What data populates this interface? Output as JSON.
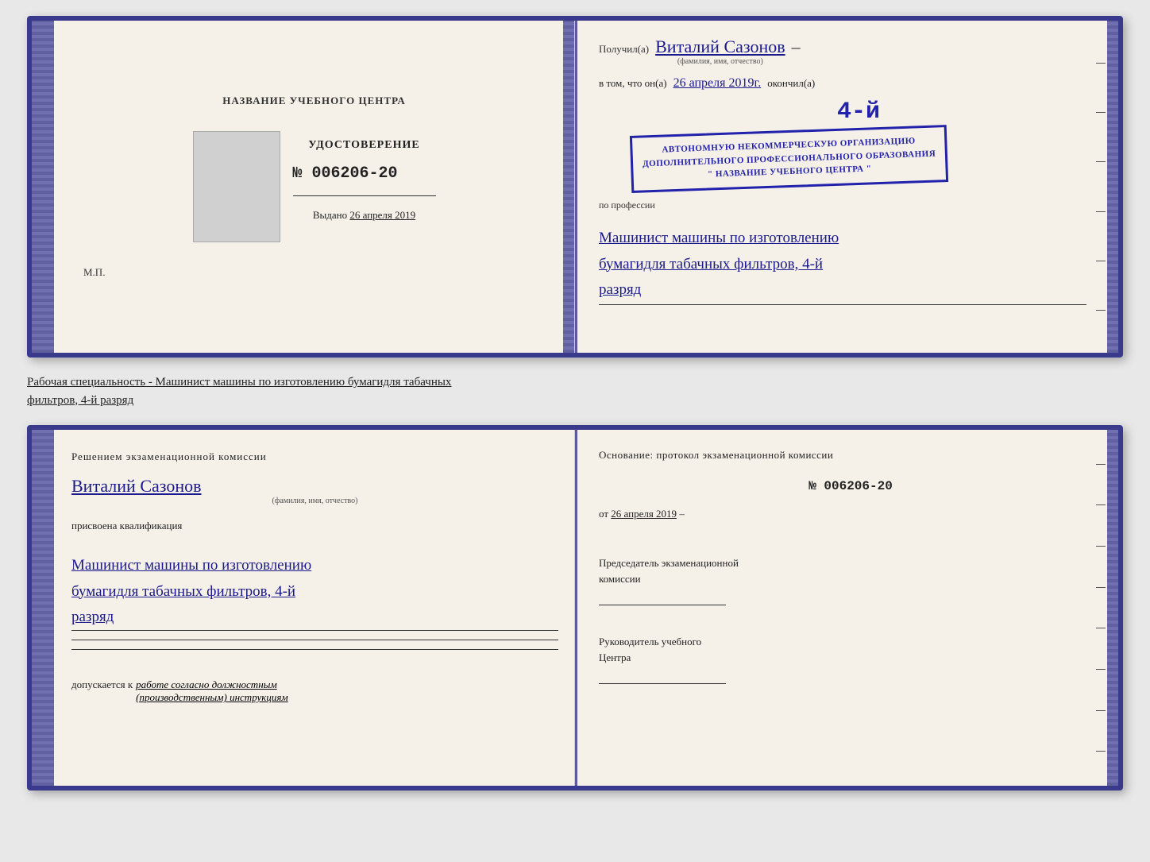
{
  "cert": {
    "left": {
      "center_label": "НАЗВАНИЕ УЧЕБНОГО ЦЕНТРА",
      "doc_type": "УДОСТОВЕРЕНИЕ",
      "doc_number": "№ 006206-20",
      "issued_label": "Выдано",
      "issued_date": "26 апреля 2019",
      "mp": "М.П."
    },
    "right": {
      "recipient_prefix": "Получил(а)",
      "recipient_name": "Виталий Сазонов",
      "recipient_subtitle": "(фамилия, имя, отчество)",
      "body_1": "в том, что он(а)",
      "date_handwritten": "26 апреля 2019г.",
      "body_2": "окончил(а)",
      "stamp_line1": "4-й",
      "stamp_line2": "АВТОНОМНУЮ НЕКОММЕРЧЕСКУЮ ОРГАНИЗАЦИЮ",
      "stamp_line3": "ДОПОЛНИТЕЛЬНОГО ПРОФЕССИОНАЛЬНОГО ОБРАЗОВАНИЯ",
      "stamp_line4": "\" НАЗВАНИЕ УЧЕБНОГО ЦЕНТРА \"",
      "profession_prefix": "по профессии",
      "profession_handwritten": "Машинист машины по изготовлению\nбумагидля табачных фильтров, 4-й\nразряд"
    }
  },
  "middle_text": {
    "static": "Рабочая специальность - Машинист машины по изготовлению бумагидля табачных",
    "underlined": "фильтров, 4-й разряд"
  },
  "qual": {
    "left": {
      "title": "Решением  экзаменационной  комиссии",
      "person_name": "Виталий Сазонов",
      "person_subtitle": "(фамилия, имя, отчество)",
      "qualification_label": "присвоена квалификация",
      "qualification_handwritten": "Машинист машины по изготовлению\nбумагидля табачных фильтров, 4-й\nразряд",
      "admission_prefix": "допускается к",
      "admission_italic": "работе согласно должностным\n(производственным) инструкциям"
    },
    "right": {
      "foundation_label": "Основание:  протокол  экзаменационной  комиссии",
      "protocol_number": "№  006206-20",
      "from_label": "от",
      "from_date": "26 апреля 2019",
      "chairman_label": "Председатель экзаменационной\nкомиссии",
      "director_label": "Руководитель учебного\nЦентра"
    }
  }
}
